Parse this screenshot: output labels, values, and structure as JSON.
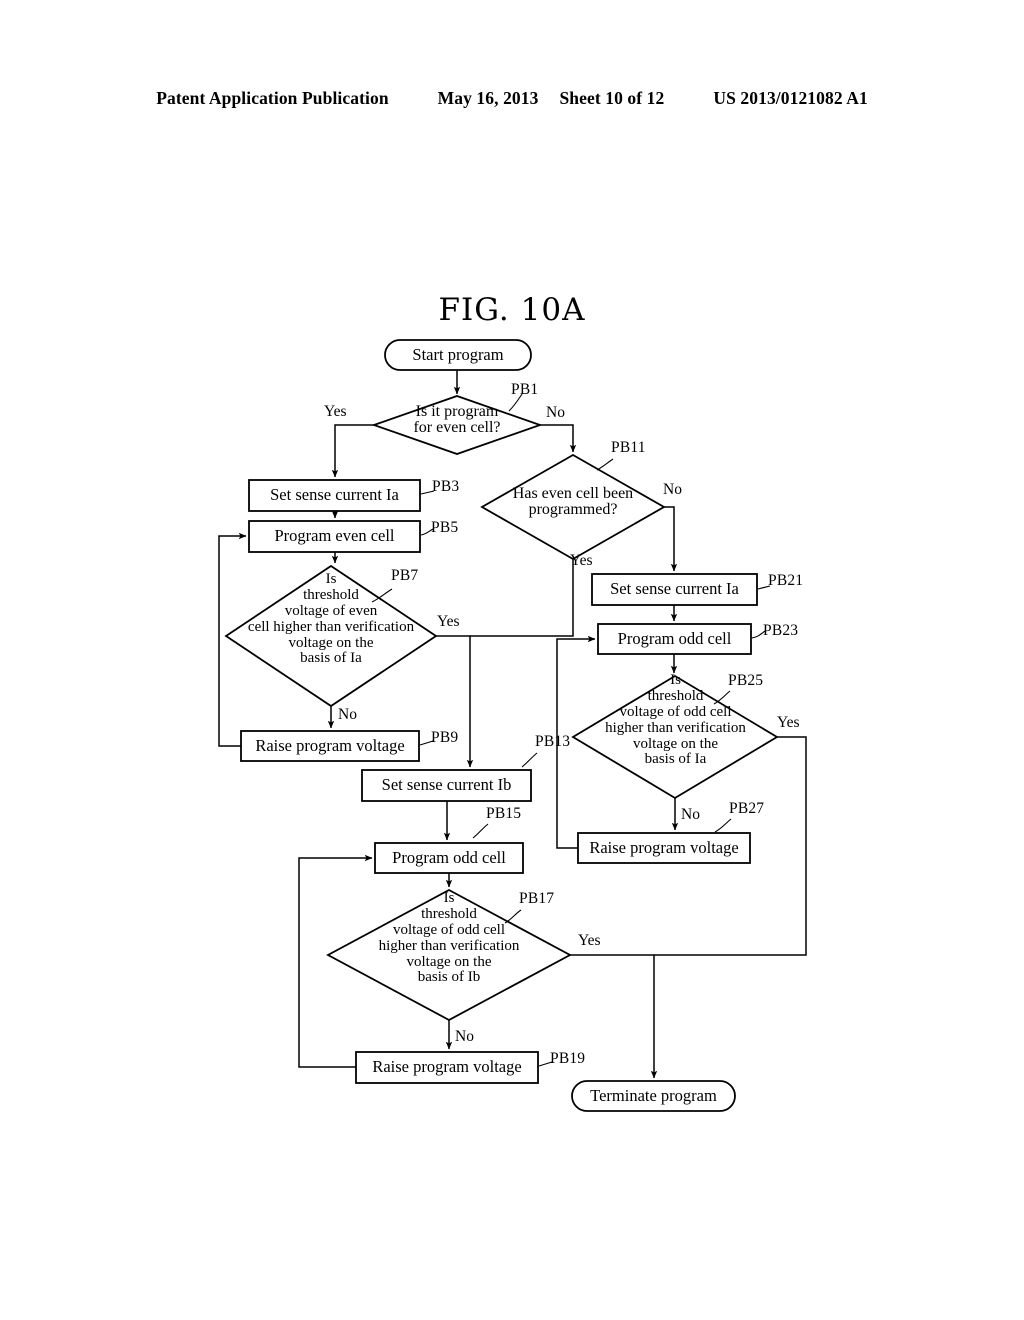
{
  "header": {
    "publication": "Patent Application Publication",
    "date": "May 16, 2013",
    "sheet": "Sheet 10 of 12",
    "patent_number": "US 2013/0121082 A1"
  },
  "figure": {
    "title": "FIG. 10A",
    "type": "flowchart"
  },
  "nodes": {
    "start": {
      "label": "Start program",
      "shape": "terminator"
    },
    "pb1": {
      "label": "Is it program\nfor even cell?",
      "shape": "decision",
      "ref": "PB1"
    },
    "pb3": {
      "label": "Set sense current Ia",
      "shape": "process",
      "ref": "PB3"
    },
    "pb5": {
      "label": "Program even cell",
      "shape": "process",
      "ref": "PB5"
    },
    "pb7": {
      "label": "Is\nthreshold\nvoltage of even\ncell higher than verification\nvoltage on the\nbasis of Ia",
      "shape": "decision",
      "ref": "PB7"
    },
    "pb9": {
      "label": "Raise program voltage",
      "shape": "process",
      "ref": "PB9"
    },
    "pb11": {
      "label": "Has even cell been\nprogrammed?",
      "shape": "decision",
      "ref": "PB11"
    },
    "pb13": {
      "label": "Set sense current Ib",
      "shape": "process",
      "ref": "PB13"
    },
    "pb15": {
      "label": "Program odd cell",
      "shape": "process",
      "ref": "PB15"
    },
    "pb17": {
      "label": "Is\nthreshold\nvoltage of odd cell\nhigher than  verification\nvoltage on the\nbasis of Ib",
      "shape": "decision",
      "ref": "PB17"
    },
    "pb19": {
      "label": "Raise program voltage",
      "shape": "process",
      "ref": "PB19"
    },
    "pb21": {
      "label": "Set sense current Ia",
      "shape": "process",
      "ref": "PB21"
    },
    "pb23": {
      "label": "Program odd cell",
      "shape": "process",
      "ref": "PB23"
    },
    "pb25": {
      "label": "Is\nthreshold\nvoltage of odd cell\nhigher than verification\nvoltage on the\nbasis of Ia",
      "shape": "decision",
      "ref": "PB25"
    },
    "pb27": {
      "label": "Raise program voltage",
      "shape": "process",
      "ref": "PB27"
    },
    "end": {
      "label": "Terminate program",
      "shape": "terminator"
    }
  },
  "edge_labels": {
    "pb1_yes": "Yes",
    "pb1_no": "No",
    "pb7_yes": "Yes",
    "pb7_no": "No",
    "pb11_yes": "Yes",
    "pb11_no": "No",
    "pb17_yes": "Yes",
    "pb17_no": "No",
    "pb25_yes": "Yes",
    "pb25_no": "No"
  },
  "refs": {
    "pb1": "PB1",
    "pb3": "PB3",
    "pb5": "PB5",
    "pb7": "PB7",
    "pb9": "PB9",
    "pb11": "PB11",
    "pb13": "PB13",
    "pb15": "PB15",
    "pb17": "PB17",
    "pb19": "PB19",
    "pb21": "PB21",
    "pb23": "PB23",
    "pb25": "PB25",
    "pb27": "PB27"
  },
  "colors": {
    "stroke": "#000000",
    "background": "#ffffff"
  }
}
